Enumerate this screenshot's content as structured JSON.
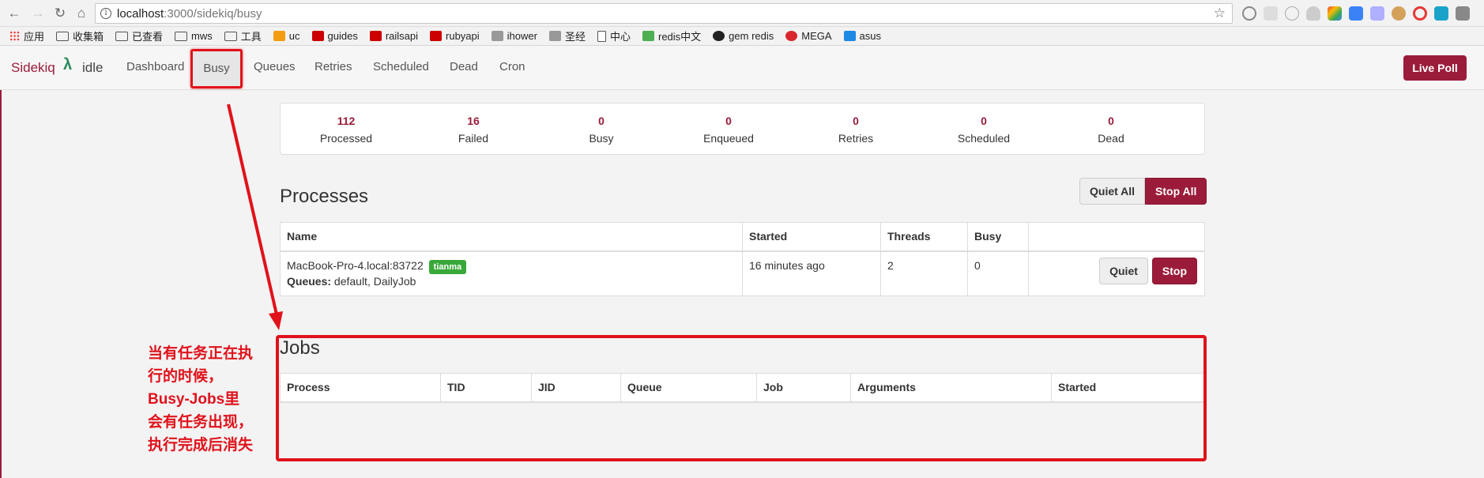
{
  "browser": {
    "url_host": "localhost",
    "url_path": ":3000/sidekiq/busy",
    "bookmarks": [
      {
        "label": "应用",
        "icon": "apps-icon"
      },
      {
        "label": "收集箱",
        "icon": "folder-icon"
      },
      {
        "label": "已查看",
        "icon": "folder-icon"
      },
      {
        "label": "mws",
        "icon": "folder-icon"
      },
      {
        "label": "工具",
        "icon": "folder-icon"
      },
      {
        "label": "uc",
        "icon": "uc-icon",
        "color": "#f39c12"
      },
      {
        "label": "guides",
        "icon": "rails-icon",
        "color": "#cc0000"
      },
      {
        "label": "railsapi",
        "icon": "rails-icon",
        "color": "#cc0000"
      },
      {
        "label": "rubyapi",
        "icon": "ruby-icon",
        "color": "#cc0000"
      },
      {
        "label": "ihower",
        "icon": "ihower-icon",
        "color": "#999999"
      },
      {
        "label": "圣经",
        "icon": "bible-icon",
        "color": "#999999"
      },
      {
        "label": "中心",
        "icon": "doc-icon"
      },
      {
        "label": "redis中文",
        "icon": "redis-icon",
        "color": "#4caf50"
      },
      {
        "label": "gem redis",
        "icon": "github-icon",
        "color": "#222222"
      },
      {
        "label": "MEGA",
        "icon": "mega-icon",
        "color": "#d9272e"
      },
      {
        "label": "asus",
        "icon": "asus-icon",
        "color": "#1e88e5"
      }
    ]
  },
  "navbar": {
    "brand": "Sidekiq",
    "status": "idle",
    "items": [
      "Dashboard",
      "Busy",
      "Queues",
      "Retries",
      "Scheduled",
      "Dead",
      "Cron"
    ],
    "active": "Busy",
    "live_poll": "Live Poll"
  },
  "summary": [
    {
      "value": "112",
      "label": "Processed"
    },
    {
      "value": "16",
      "label": "Failed"
    },
    {
      "value": "0",
      "label": "Busy"
    },
    {
      "value": "0",
      "label": "Enqueued"
    },
    {
      "value": "0",
      "label": "Retries"
    },
    {
      "value": "0",
      "label": "Scheduled"
    },
    {
      "value": "0",
      "label": "Dead"
    }
  ],
  "processes": {
    "title": "Processes",
    "quiet_all": "Quiet All",
    "stop_all": "Stop All",
    "columns": [
      "Name",
      "Started",
      "Threads",
      "Busy"
    ],
    "rows": [
      {
        "name": "MacBook-Pro-4.local:83722",
        "tag": "tianma",
        "queues_label": "Queues:",
        "queues": "default, DailyJob",
        "started": "16 minutes ago",
        "threads": "2",
        "busy": "0",
        "quiet": "Quiet",
        "stop": "Stop"
      }
    ]
  },
  "jobs": {
    "title": "Jobs",
    "columns": [
      "Process",
      "TID",
      "JID",
      "Queue",
      "Job",
      "Arguments",
      "Started"
    ]
  },
  "annotation": {
    "lines": [
      "当有任务正在执",
      "行的时候，",
      "Busy-Jobs里",
      "会有任务出现，",
      "执行完成后消失"
    ]
  },
  "colors": {
    "brand": "#9b1c3a",
    "annotation": "#e0121b",
    "success": "#39a839"
  }
}
